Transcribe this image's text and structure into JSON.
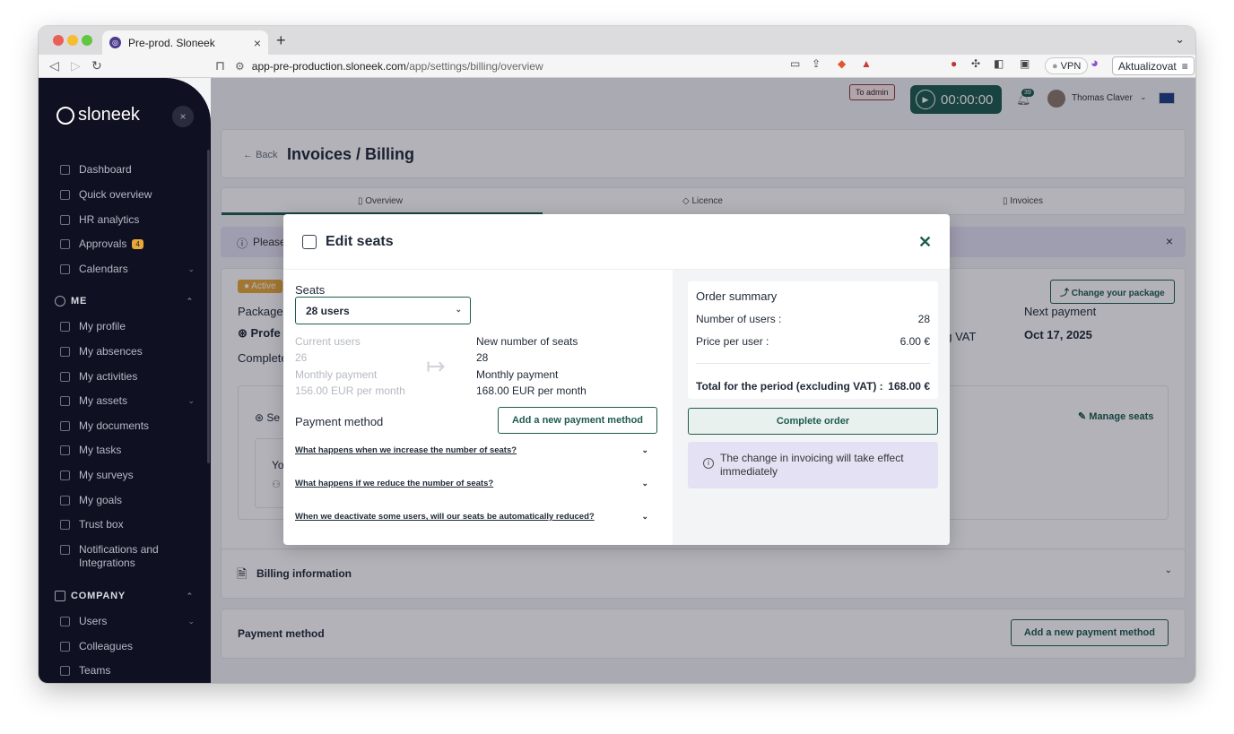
{
  "browser": {
    "tab_title": "Pre-prod. Sloneek",
    "url_host": "app-pre-production.sloneek.com",
    "url_path": "/app/settings/billing/overview",
    "vpn_label": "VPN",
    "update_label": "Aktualizovat"
  },
  "sidebar": {
    "logo": "sloneek",
    "close_label": "×",
    "items": [
      {
        "label": "Dashboard"
      },
      {
        "label": "Quick overview"
      },
      {
        "label": "HR analytics"
      },
      {
        "label": "Approvals",
        "badge": "4"
      },
      {
        "label": "Calendars"
      }
    ],
    "me_section": "ME",
    "me_items": [
      {
        "label": "My profile"
      },
      {
        "label": "My absences"
      },
      {
        "label": "My activities"
      },
      {
        "label": "My assets"
      },
      {
        "label": "My documents"
      },
      {
        "label": "My tasks"
      },
      {
        "label": "My surveys"
      },
      {
        "label": "My goals"
      },
      {
        "label": "Trust box"
      },
      {
        "label": "Notifications and Integrations"
      }
    ],
    "company_section": "COMPANY",
    "company_items": [
      {
        "label": "Users"
      },
      {
        "label": "Colleagues"
      },
      {
        "label": "Teams"
      }
    ]
  },
  "header": {
    "to_admin": "To admin",
    "timer": "00:00:00",
    "notifications": "39",
    "user_name": "Thomas Claver"
  },
  "page": {
    "back": "Back",
    "title": "Invoices / Billing",
    "tabs": [
      {
        "label": "Overview"
      },
      {
        "label": "Licence"
      },
      {
        "label": "Invoices"
      }
    ],
    "banner_text": "Please",
    "status_badge": "Active",
    "package_label": "Package",
    "package_name": "Profe",
    "complete_text": "Complete",
    "change_package": "Change your package",
    "next_payment_label": "Next payment",
    "next_payment_value": "Oct 17, 2025",
    "vat_fragment": "ng VAT",
    "seats_fragment": "Se",
    "you_fragment": "Yo",
    "manage_seats": "Manage seats",
    "billing_information": "Billing information",
    "payment_method": "Payment method",
    "add_payment_method": "Add a new payment method"
  },
  "modal": {
    "title": "Edit seats",
    "seats_label": "Seats",
    "seats_selected": "28 users",
    "current_users_label": "Current users",
    "current_users_value": "26",
    "monthly_payment_label": "Monthly payment",
    "current_monthly_value": "156.00 EUR per month",
    "new_seats_label": "New number of seats",
    "new_seats_value": "28",
    "new_monthly_label": "Monthly payment",
    "new_monthly_value": "168.00 EUR per month",
    "payment_method_label": "Payment method",
    "add_payment_button": "Add a new payment method",
    "faq": [
      {
        "q": "What happens when we increase the number of seats?"
      },
      {
        "q": "What happens if we reduce the number of seats?"
      },
      {
        "q": "When we deactivate some users, will our seats be automatically reduced?"
      }
    ],
    "summary": {
      "title": "Order summary",
      "users_label": "Number of users :",
      "users_value": "28",
      "price_label": "Price per user :",
      "price_value": "6.00 €",
      "total_label": "Total for the period (excluding VAT) :",
      "total_value": "168.00 €"
    },
    "complete_button": "Complete order",
    "info_text": "The change in invoicing will take effect immediately"
  },
  "colors": {
    "brand": "#1e5c4f",
    "sidebar": "#0f1021",
    "info_bg": "#e4e1f4",
    "badge": "#e8a93a"
  }
}
